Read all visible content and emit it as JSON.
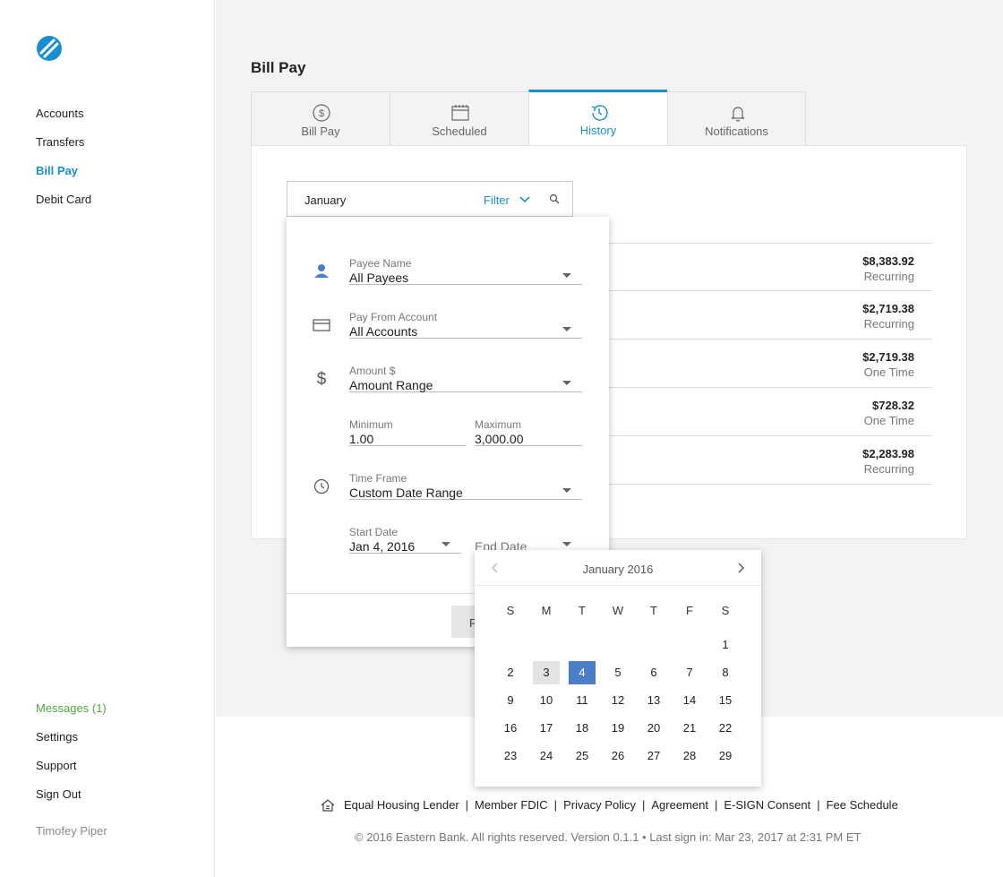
{
  "sidebar": {
    "nav": [
      "Accounts",
      "Transfers",
      "Bill Pay",
      "Debit Card"
    ],
    "active_nav": "Bill Pay",
    "bottom": [
      "Messages (1)",
      "Settings",
      "Support",
      "Sign Out"
    ],
    "user": "Timofey Piper"
  },
  "main": {
    "title": "Bill Pay",
    "tabs": [
      {
        "label": "Bill Pay",
        "icon": "dollar-circle-icon"
      },
      {
        "label": "Scheduled",
        "icon": "calendar-icon"
      },
      {
        "label": "History",
        "icon": "history-icon"
      },
      {
        "label": "Notifications",
        "icon": "bell-icon"
      }
    ],
    "active_tab": "History",
    "search": {
      "value": "January",
      "filter_label": "Filter"
    },
    "history": [
      {
        "amount": "$8,383.92",
        "type": "Recurring"
      },
      {
        "amount": "$2,719.38",
        "type": "Recurring"
      },
      {
        "amount": "$2,719.38",
        "type": "One Time"
      },
      {
        "amount": "$728.32",
        "type": "One Time"
      },
      {
        "amount": "$2,283.98",
        "type": "Recurring"
      }
    ]
  },
  "filter": {
    "payee": {
      "label": "Payee Name",
      "value": "All Payees"
    },
    "account": {
      "label": "Pay From Account",
      "value": "All Accounts"
    },
    "amount": {
      "label": "Amount $",
      "value": "Amount Range"
    },
    "minimum": {
      "label": "Minimum",
      "value": "1.00"
    },
    "maximum": {
      "label": "Maximum",
      "value": "3,000.00"
    },
    "timeframe": {
      "label": "Time Frame",
      "value": "Custom Date Range"
    },
    "start_date": {
      "label": "Start Date",
      "value": "Jan 4, 2016"
    },
    "end_date": {
      "label": "End Date"
    },
    "button_label": "F"
  },
  "calendar": {
    "title": "January 2016",
    "dow": [
      "S",
      "M",
      "T",
      "W",
      "T",
      "F",
      "S"
    ],
    "weeks": [
      [
        "",
        "",
        "",
        "",
        "",
        "",
        "1"
      ],
      [
        "2",
        "3",
        "4",
        "5",
        "6",
        "7",
        "8"
      ],
      [
        "9",
        "10",
        "11",
        "12",
        "13",
        "14",
        "15"
      ],
      [
        "16",
        "17",
        "18",
        "19",
        "20",
        "21",
        "22"
      ],
      [
        "23",
        "24",
        "25",
        "26",
        "27",
        "28",
        "29"
      ]
    ],
    "today": "3",
    "selected": "4",
    "accent": "#4a7ec7"
  },
  "footer": {
    "links": [
      "Equal Housing Lender",
      "Member FDIC",
      "Privacy Policy",
      "Agreement",
      "E-SIGN Consent",
      "Fee Schedule"
    ],
    "copyright": "© 2016 Eastern Bank. All rights reserved. Version 0.1.1 • Last sign in: Mar 23, 2017 at 2:31 PM ET"
  },
  "colors": {
    "brand": "#1a8fd0",
    "messages": "#4caa3c"
  }
}
